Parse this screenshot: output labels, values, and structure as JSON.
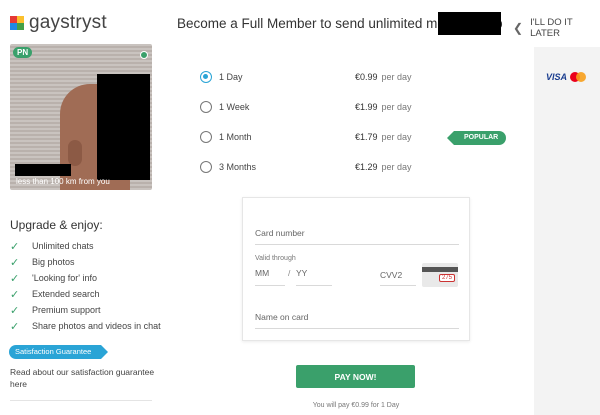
{
  "brand": {
    "logo_text": "gaystryst"
  },
  "header": {
    "message": "Become a Full Member to send unlimited messages to",
    "later_label": "I'LL DO IT LATER"
  },
  "profile": {
    "badge": "PN",
    "distance": "less than 100 km from you"
  },
  "upgrade": {
    "title": "Upgrade & enjoy:",
    "features": [
      "Unlimited chats",
      "Big photos",
      "'Looking for' info",
      "Extended search",
      "Premium support",
      "Share photos and videos in chat"
    ]
  },
  "guarantee": {
    "tag": "Satisfaction Guarantee",
    "text": "Read about our satisfaction guarantee here"
  },
  "plans": [
    {
      "name": "1 Day",
      "price": "€0.99",
      "per": "per day",
      "selected": true
    },
    {
      "name": "1 Week",
      "price": "€1.99",
      "per": "per day",
      "selected": false
    },
    {
      "name": "1 Month",
      "price": "€1.79",
      "per": "per day",
      "selected": false
    },
    {
      "name": "3 Months",
      "price": "€1.29",
      "per": "per day",
      "selected": false
    }
  ],
  "popular_label": "POPULAR",
  "payment_logos": {
    "visa": "VISA",
    "mastercard_colors": [
      "#eb001b",
      "#f79e1b"
    ]
  },
  "card_form": {
    "card_number_placeholder": "Card number",
    "valid_through_label": "Valid through",
    "mm_placeholder": "MM",
    "slash": "/",
    "yy_placeholder": "YY",
    "cvv_placeholder": "CVV2",
    "cvv_example": "275",
    "name_placeholder": "Name on card"
  },
  "pay_button": "PAY NOW!",
  "pay_note": "You will pay €0.99 for 1 Day",
  "colors": {
    "accent_green": "#3aa06b",
    "accent_blue": "#2aa4d6"
  }
}
